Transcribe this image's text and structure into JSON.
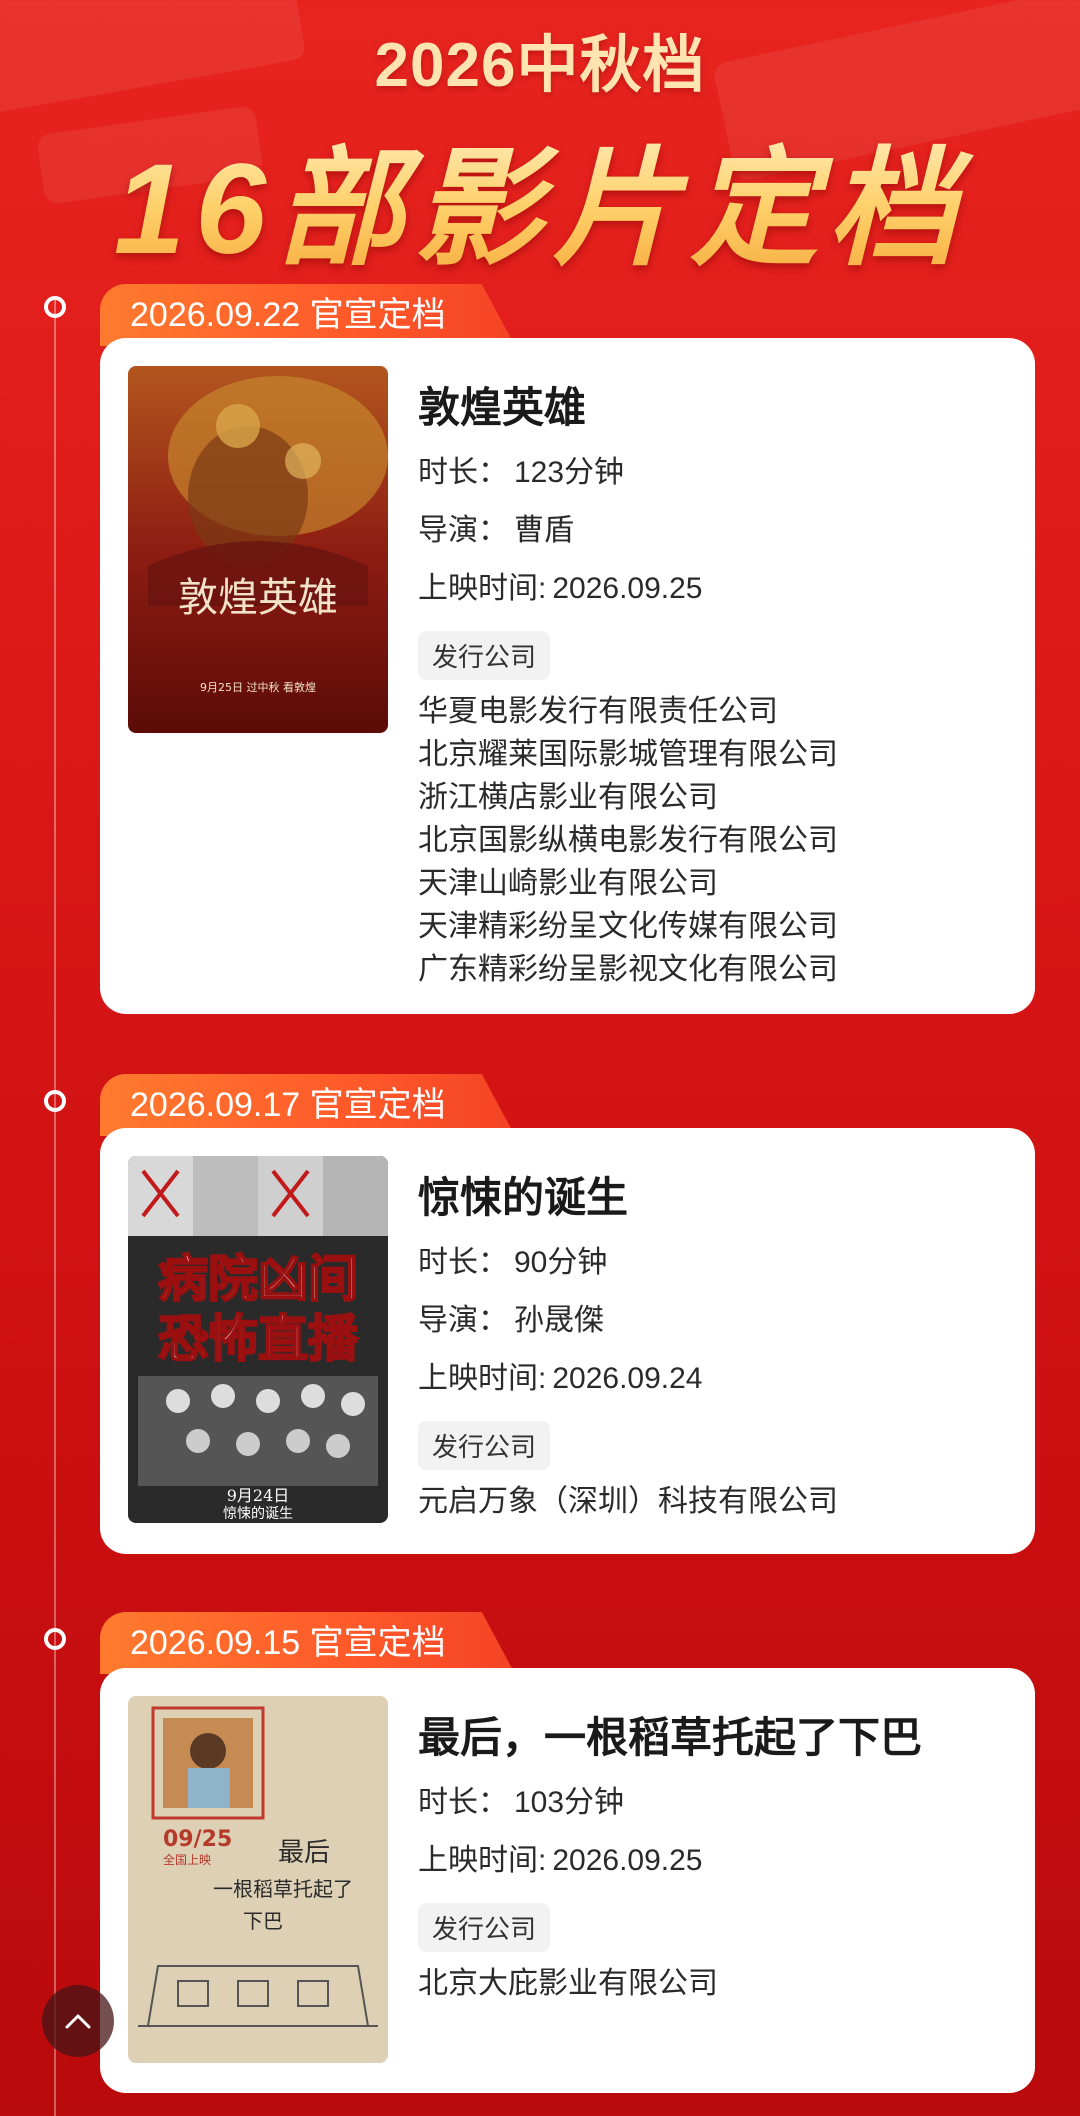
{
  "header": {
    "year_line": "2026中秋档",
    "main_line": "16部影片定档"
  },
  "labels": {
    "duration": "时长：",
    "director": "导演：",
    "release": "上映时间:",
    "distributor_pill": "发行公司"
  },
  "films": [
    {
      "date_tag": "2026.09.22 官宣定档",
      "title": "敦煌英雄",
      "duration": "123分钟",
      "director": "曹盾",
      "release": "2026.09.25",
      "poster_text": "敦煌英雄",
      "poster_caption": "9月25日   过中秋   看敦煌",
      "companies": [
        "华夏电影发行有限责任公司",
        "北京耀莱国际影城管理有限公司",
        "浙江横店影业有限公司",
        "北京国影纵横电影发行有限公司",
        "天津山崎影业有限公司",
        "天津精彩纷呈文化传媒有限公司",
        "广东精彩纷呈影视文化有限公司"
      ]
    },
    {
      "date_tag": "2026.09.17 官宣定档",
      "title": "惊悚的诞生",
      "duration": "90分钟",
      "director": "孙晟傑",
      "release": "2026.09.24",
      "poster_text_1": "病院凶间",
      "poster_text_2": "恐怖直播",
      "poster_caption_1": "9月24日",
      "poster_caption_2": "惊悚的诞生",
      "companies": [
        "元启万象（深圳）科技有限公司"
      ]
    },
    {
      "date_tag": "2026.09.15 官宣定档",
      "title": "最后，一根稻草托起了下巴",
      "duration": "103分钟",
      "release": "2026.09.25",
      "poster_date": "09/25",
      "poster_sub": "全国上映",
      "poster_title_1": "最后",
      "poster_title_2": "一根稻草托起了",
      "poster_title_3": "下巴",
      "companies": [
        "北京大庇影业有限公司"
      ]
    }
  ],
  "icons": {
    "scroll_top": "chevron-up-icon"
  },
  "colors": {
    "background_red": "#d81616",
    "tag_orange": "#ff6a2c",
    "gold": "#ffd98a"
  }
}
